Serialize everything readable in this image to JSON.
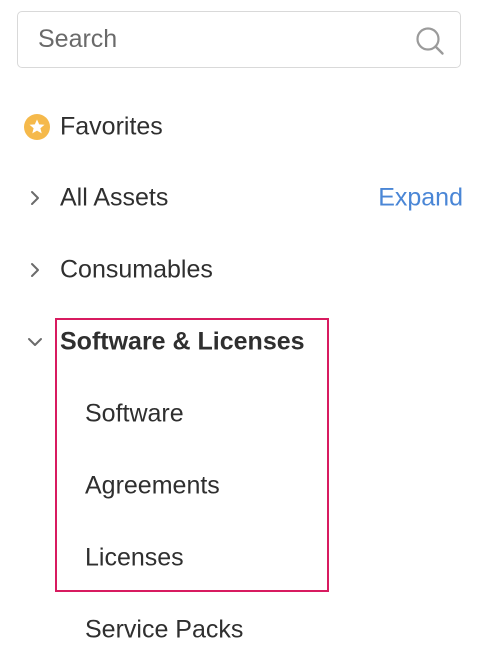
{
  "search": {
    "placeholder": "Search",
    "icon": "search-icon"
  },
  "nav": {
    "favorites": {
      "label": "Favorites",
      "icon": "star-badge-icon",
      "icon_color": "#f5b94b"
    },
    "all_assets": {
      "label": "All Assets",
      "expand_label": "Expand",
      "expanded": false
    },
    "consumables": {
      "label": "Consumables",
      "expanded": false
    },
    "software_licenses": {
      "label": "Software & Licenses",
      "expanded": true,
      "highlight_color": "#d81b60",
      "children": [
        {
          "label": "Software"
        },
        {
          "label": "Agreements"
        },
        {
          "label": "Licenses"
        }
      ]
    },
    "service_packs": {
      "label": "Service Packs"
    }
  },
  "colors": {
    "link": "#4a86d6",
    "text": "#2f2f2f",
    "highlight": "#d81b60"
  }
}
